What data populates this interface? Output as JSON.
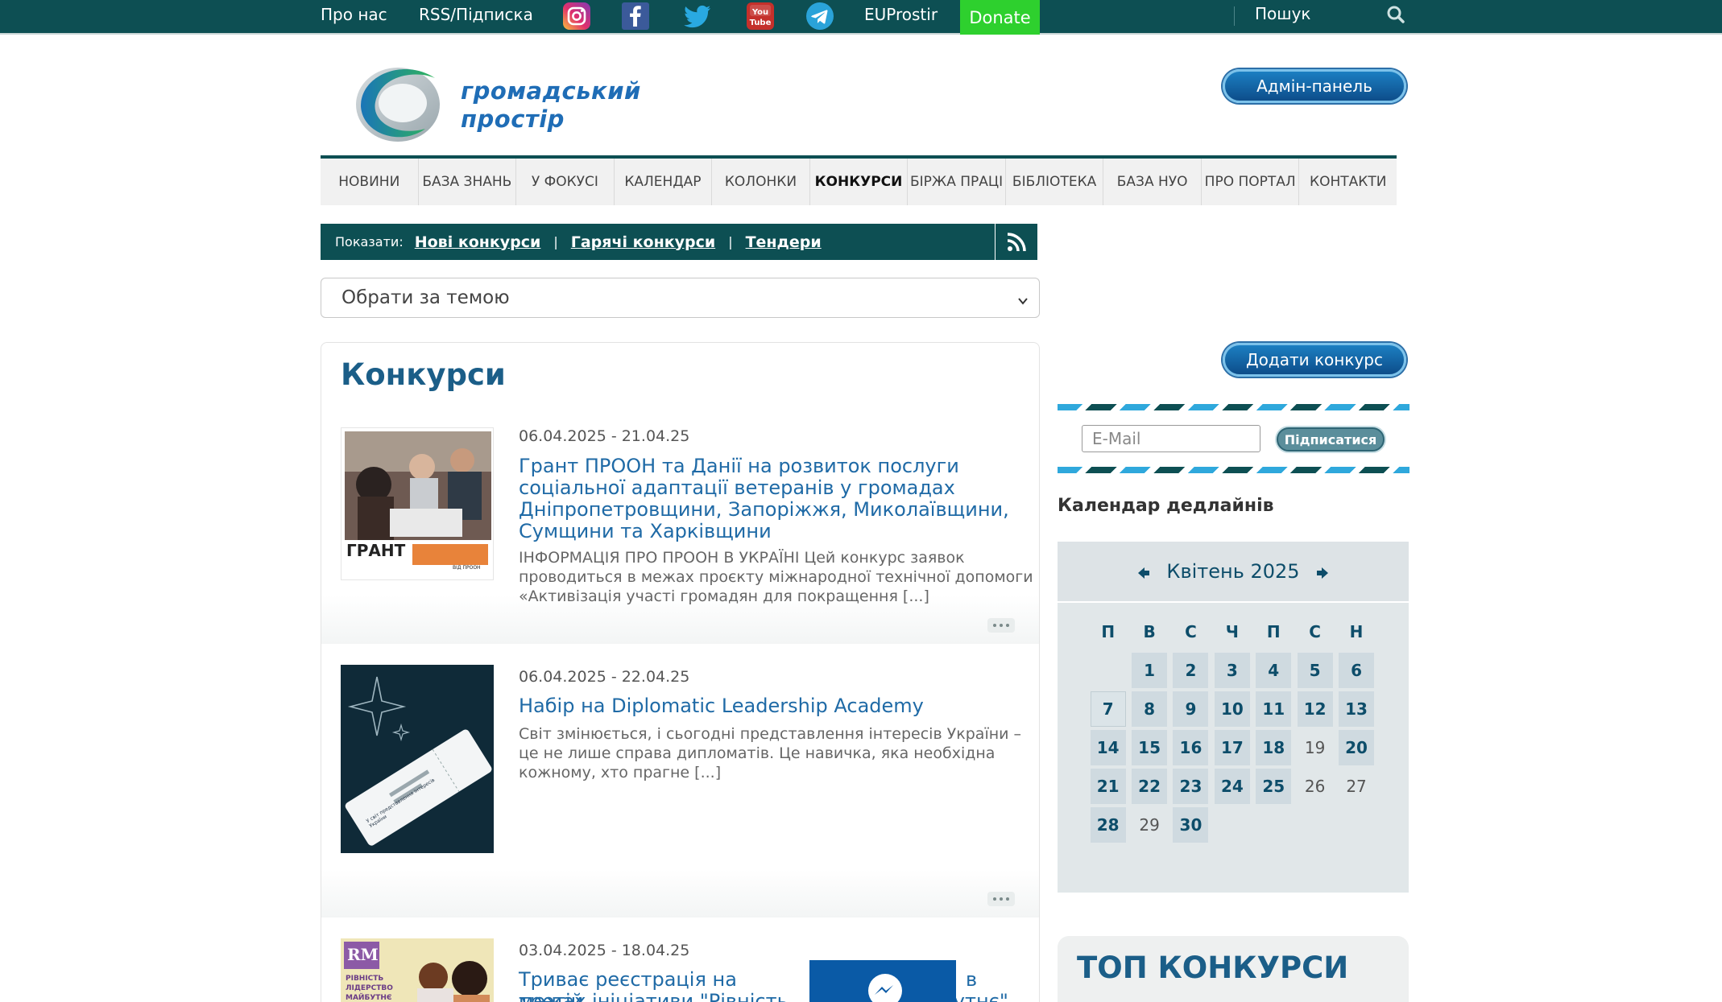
{
  "topbar": {
    "about": "Про нас",
    "rss": "RSS/Підписка",
    "social": [
      "instagram-icon",
      "facebook-icon",
      "twitter-icon",
      "youtube-icon",
      "telegram-icon"
    ],
    "youtube_text": "You Tube",
    "euprostir": "EUProstir",
    "donate": "Donate",
    "search_label": "Пошук"
  },
  "header": {
    "logo_line1": "громадський",
    "logo_line2": "простір",
    "admin_button": "Адмін-панель"
  },
  "nav": {
    "items": [
      "НОВИНИ",
      "БАЗА ЗНАНЬ",
      "У ФОКУСІ",
      "КАЛЕНДАР",
      "КОЛОНКИ",
      "КОНКУРСИ",
      "БІРЖА ПРАЦІ",
      "БІБЛІОТЕКА",
      "БАЗА НУО",
      "ПРО ПОРТАЛ",
      "КОНТАКТИ"
    ],
    "active": "КОНКУРСИ"
  },
  "filter": {
    "label": "Показати:",
    "links": [
      "Нові конкурси",
      "Гарячі конкурси",
      "Тендери"
    ],
    "separator": "|"
  },
  "topic_select": {
    "selected": "Обрати за темою"
  },
  "main": {
    "title": "Конкурси",
    "items": [
      {
        "date": "06.04.2025 - 21.04.25",
        "title": "Грант ПРООН та Данії на розвиток послуги соціальної адаптації ветеранів у громадах Дніпропетровщини, Запоріжжя, Миколаївщини, Сумщини та Харківщини",
        "excerpt": "ІНФОРМАЦІЯ ПРО ПРООН В УКРАЇНІ Цей конкурс заявок проводиться в межах проєкту міжнародної технічної допомоги «Активізація участі громадян для покращення [...]",
        "thumb_label": "ГРАНТ",
        "thumb_badge": "ВІД ПРООН"
      },
      {
        "date": "06.04.2025 - 22.04.25",
        "title": "Набір на Diplomatic Leadership Academy",
        "excerpt": "Світ змінюється, і сьогодні представлення інтересів України – це не лише справа дипломатів. Це навичка, яка необхідна кожному, хто прагне [...]",
        "thumb_ticket": "У світ представлення інтересів України"
      },
      {
        "date": "03.04.2025 - 18.04.25",
        "title": "Триває реєстрація на третій",
        "title_right": "в",
        "title_line2_left": "межах ініціативи \"Рівність   Л",
        "title_line2_right": "бутнє\"",
        "thumb_logo": "RM",
        "thumb_text": "РІВНІСТЬ ЛІДЕРСТВО МАЙБУТНЄ"
      }
    ]
  },
  "sidebar": {
    "add_button": "Додати конкурс",
    "email_placeholder": "E-Mail",
    "subscribe_button": "Підписатися",
    "calendar_heading": "Календар дедлайнів",
    "calendar": {
      "month": "Квітень 2025",
      "weekdays": [
        "П",
        "В",
        "С",
        "Ч",
        "П",
        "С",
        "Н"
      ],
      "weeks": [
        [
          "",
          "1",
          "2",
          "3",
          "4",
          "5",
          "6"
        ],
        [
          "7",
          "8",
          "9",
          "10",
          "11",
          "12",
          "13"
        ],
        [
          "14",
          "15",
          "16",
          "17",
          "18",
          "19",
          "20"
        ],
        [
          "21",
          "22",
          "23",
          "24",
          "25",
          "26",
          "27"
        ],
        [
          "28",
          "29",
          "30",
          "",
          "",
          "",
          ""
        ]
      ],
      "no_event_days": [
        "19",
        "26",
        "27",
        "29"
      ],
      "today": "7"
    },
    "top_title": "ТОП КОНКУРСИ"
  },
  "colors": {
    "topbar": "#0d4f53",
    "donate": "#2ed02e",
    "link": "#1f6aa6",
    "title": "#1b5e88",
    "messenger": "#0a5aa6"
  }
}
